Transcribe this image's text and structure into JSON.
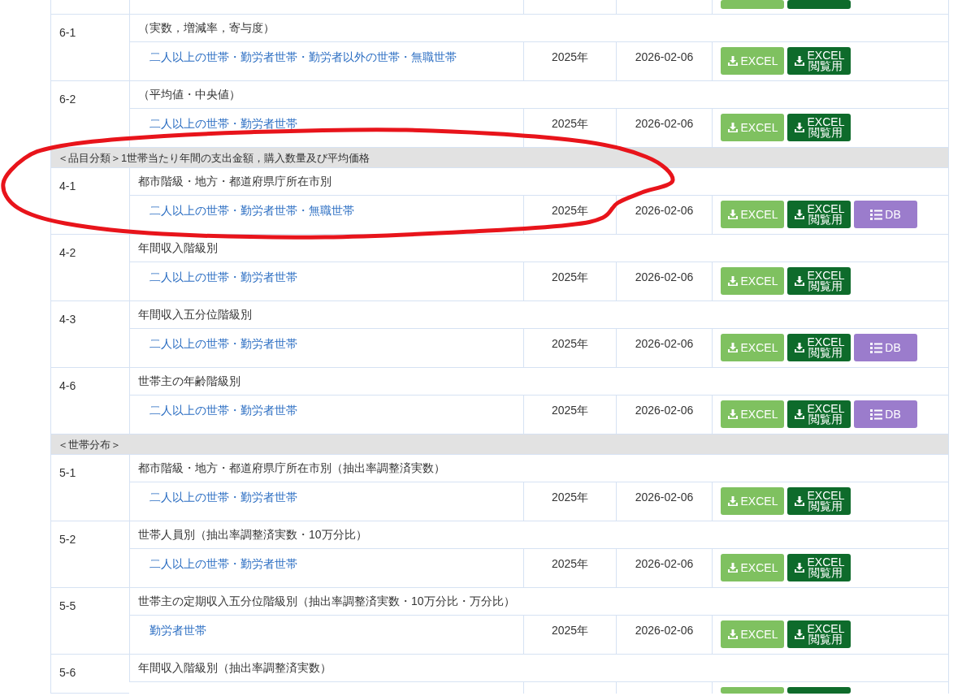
{
  "table": [
    {
      "kind": "cut_row",
      "buttons": [
        {
          "kind": "excel"
        },
        {
          "kind": "excel_view"
        }
      ]
    },
    {
      "kind": "group",
      "code": "6-1",
      "subtitle": "（実数，増減率，寄与度）",
      "items": [
        {
          "label": "二人以上の世帯・勤労者世帯・勤労者以外の世帯・無職世帯",
          "year": "2025年",
          "date": "2026-02-06",
          "buttons": [
            {
              "kind": "excel",
              "label": "EXCEL"
            },
            {
              "kind": "excel_view",
              "label": "EXCEL",
              "sublabel": "閲覧用"
            }
          ]
        }
      ]
    },
    {
      "kind": "group",
      "code": "6-2",
      "subtitle": "（平均値・中央値）",
      "items": [
        {
          "label": "二人以上の世帯・勤労者世帯",
          "year": "2025年",
          "date": "2026-02-06",
          "buttons": [
            {
              "kind": "excel",
              "label": "EXCEL"
            },
            {
              "kind": "excel_view",
              "label": "EXCEL",
              "sublabel": "閲覧用"
            }
          ]
        }
      ]
    },
    {
      "kind": "section",
      "title": "＜品目分類＞1世帯当たり年間の支出金額，購入数量及び平均価格"
    },
    {
      "kind": "group",
      "code": "4-1",
      "subtitle": "都市階級・地方・都道府県庁所在市別",
      "items": [
        {
          "label": "二人以上の世帯・勤労者世帯・無職世帯",
          "year": "2025年",
          "date": "2026-02-06",
          "buttons": [
            {
              "kind": "excel",
              "label": "EXCEL"
            },
            {
              "kind": "excel_view",
              "label": "EXCEL",
              "sublabel": "閲覧用"
            },
            {
              "kind": "db",
              "label": "DB"
            }
          ]
        }
      ]
    },
    {
      "kind": "group",
      "code": "4-2",
      "subtitle": "年間収入階級別",
      "items": [
        {
          "label": "二人以上の世帯・勤労者世帯",
          "year": "2025年",
          "date": "2026-02-06",
          "buttons": [
            {
              "kind": "excel",
              "label": "EXCEL"
            },
            {
              "kind": "excel_view",
              "label": "EXCEL",
              "sublabel": "閲覧用"
            }
          ]
        }
      ]
    },
    {
      "kind": "group",
      "code": "4-3",
      "subtitle": "年間収入五分位階級別",
      "items": [
        {
          "label": "二人以上の世帯・勤労者世帯",
          "year": "2025年",
          "date": "2026-02-06",
          "buttons": [
            {
              "kind": "excel",
              "label": "EXCEL"
            },
            {
              "kind": "excel_view",
              "label": "EXCEL",
              "sublabel": "閲覧用"
            },
            {
              "kind": "db",
              "label": "DB"
            }
          ]
        }
      ]
    },
    {
      "kind": "group",
      "code": "4-6",
      "subtitle": "世帯主の年齢階級別",
      "items": [
        {
          "label": "二人以上の世帯・勤労者世帯",
          "year": "2025年",
          "date": "2026-02-06",
          "buttons": [
            {
              "kind": "excel",
              "label": "EXCEL"
            },
            {
              "kind": "excel_view",
              "label": "EXCEL",
              "sublabel": "閲覧用"
            },
            {
              "kind": "db",
              "label": "DB"
            }
          ]
        }
      ]
    },
    {
      "kind": "section",
      "title": "＜世帯分布＞"
    },
    {
      "kind": "group",
      "code": "5-1",
      "subtitle": "都市階級・地方・都道府県庁所在市別（抽出率調整済実数）",
      "items": [
        {
          "label": "二人以上の世帯・勤労者世帯",
          "year": "2025年",
          "date": "2026-02-06",
          "buttons": [
            {
              "kind": "excel",
              "label": "EXCEL"
            },
            {
              "kind": "excel_view",
              "label": "EXCEL",
              "sublabel": "閲覧用"
            }
          ]
        }
      ]
    },
    {
      "kind": "group",
      "code": "5-2",
      "subtitle": "世帯人員別（抽出率調整済実数・10万分比）",
      "items": [
        {
          "label": "二人以上の世帯・勤労者世帯",
          "year": "2025年",
          "date": "2026-02-06",
          "buttons": [
            {
              "kind": "excel",
              "label": "EXCEL"
            },
            {
              "kind": "excel_view",
              "label": "EXCEL",
              "sublabel": "閲覧用"
            }
          ]
        }
      ]
    },
    {
      "kind": "group",
      "code": "5-5",
      "subtitle": "世帯主の定期収入五分位階級別（抽出率調整済実数・10万分比・万分比）",
      "items": [
        {
          "label": "勤労者世帯",
          "year": "2025年",
          "date": "2026-02-06",
          "buttons": [
            {
              "kind": "excel",
              "label": "EXCEL"
            },
            {
              "kind": "excel_view",
              "label": "EXCEL",
              "sublabel": "閲覧用"
            }
          ]
        }
      ]
    },
    {
      "kind": "group",
      "code": "5-6",
      "subtitle": "年間収入階級別（抽出率調整済実数）",
      "cut_row": {
        "buttons": [
          {
            "kind": "excel"
          },
          {
            "kind": "excel_view"
          }
        ]
      }
    }
  ],
  "annotation": {
    "kind": "ellipse",
    "color": "#e8141b"
  }
}
